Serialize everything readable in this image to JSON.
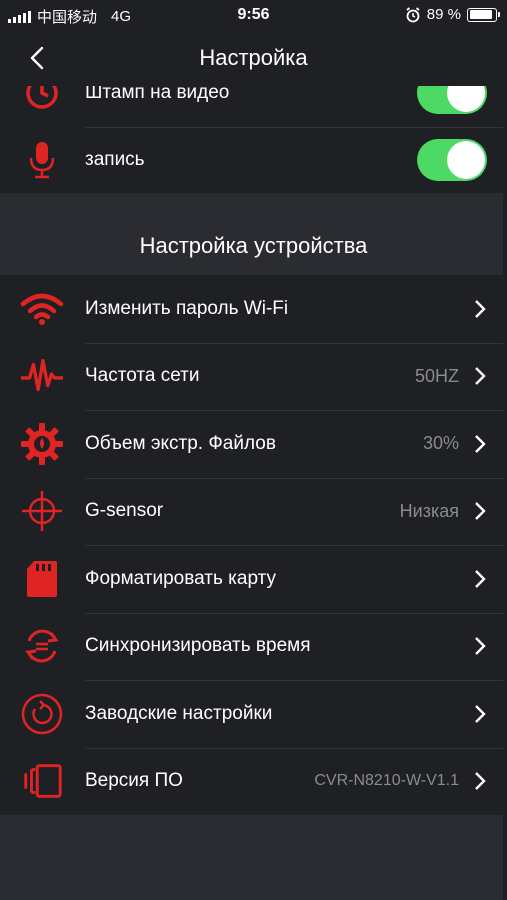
{
  "status": {
    "carrier": "中国移动",
    "network": "4G",
    "time": "9:56",
    "battery": "89 %",
    "battery_level": 0.89
  },
  "nav": {
    "title": "Настройка"
  },
  "top_group": [
    {
      "label": "Штамп на видео",
      "toggle_on": true,
      "icon": "clock-icon"
    },
    {
      "label": "запись",
      "toggle_on": true,
      "icon": "microphone-icon"
    }
  ],
  "section": {
    "title": "Настройка устройства"
  },
  "items": [
    {
      "label": "Изменить пароль Wi-Fi",
      "value": "",
      "icon": "wifi-icon"
    },
    {
      "label": "Частота сети",
      "value": "50HZ",
      "icon": "pulse-icon"
    },
    {
      "label": "Объем экстр. Файлов",
      "value": "30%",
      "icon": "gear-icon"
    },
    {
      "label": "G-sensor",
      "value": "Низкая",
      "icon": "crosshair-icon"
    },
    {
      "label": "Форматировать карту",
      "value": "",
      "icon": "sd-card-icon"
    },
    {
      "label": "Синхронизировать время",
      "value": "",
      "icon": "sync-icon"
    },
    {
      "label": "Заводские настройки",
      "value": "",
      "icon": "reset-icon"
    },
    {
      "label": "Версия ПО",
      "value": "CVR-N8210-W-V1.1",
      "icon": "device-icon"
    }
  ],
  "colors": {
    "accent": "#e02424",
    "toggle_on": "#4cd964",
    "background": "#2b2c31",
    "panel": "#1f2024"
  }
}
